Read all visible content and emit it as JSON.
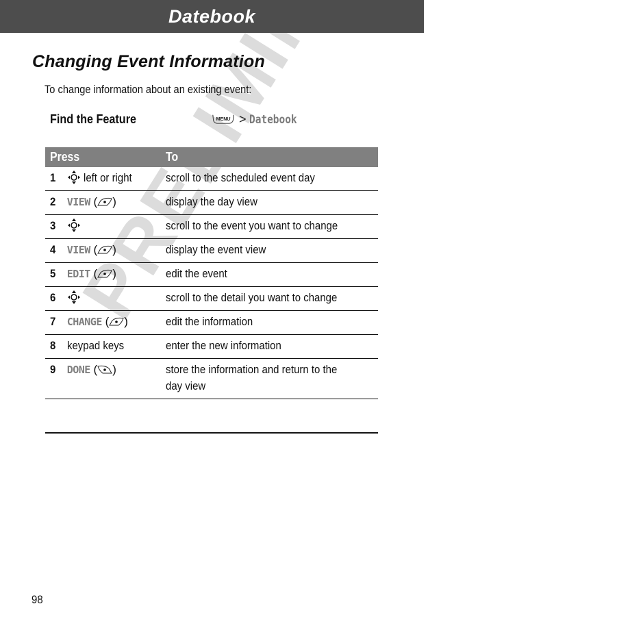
{
  "header": {
    "title": "Datebook"
  },
  "section": {
    "title": "Changing Event Information",
    "intro": "To change information about an existing event:"
  },
  "find_feature": {
    "label": "Find the Feature",
    "menu_key_label": "MENU",
    "separator": ">",
    "path": "Datebook"
  },
  "table": {
    "headers": {
      "press": "Press",
      "to": "To"
    },
    "rows": [
      {
        "num": "1",
        "press_icon": "nav-key-icon",
        "press_softkey": "",
        "press_text": "left or right",
        "key_glyph": "",
        "to": "scroll to the scheduled event day"
      },
      {
        "num": "2",
        "press_icon": "",
        "press_softkey": "VIEW",
        "press_text": "",
        "key_glyph": "right-soft-key-icon",
        "to": "display the day view"
      },
      {
        "num": "3",
        "press_icon": "nav-key-icon",
        "press_softkey": "",
        "press_text": "",
        "key_glyph": "",
        "to": "scroll to the event you want to change"
      },
      {
        "num": "4",
        "press_icon": "",
        "press_softkey": "VIEW",
        "press_text": "",
        "key_glyph": "right-soft-key-icon",
        "to": "display the event view"
      },
      {
        "num": "5",
        "press_icon": "",
        "press_softkey": "EDIT",
        "press_text": "",
        "key_glyph": "right-soft-key-icon",
        "to": "edit the event"
      },
      {
        "num": "6",
        "press_icon": "nav-key-icon",
        "press_softkey": "",
        "press_text": "",
        "key_glyph": "",
        "to": "scroll to the detail you want to change"
      },
      {
        "num": "7",
        "press_icon": "",
        "press_softkey": "CHANGE",
        "press_text": "",
        "key_glyph": "right-soft-key-icon",
        "to": "edit the information"
      },
      {
        "num": "8",
        "press_icon": "",
        "press_softkey": "",
        "press_text": "keypad keys",
        "key_glyph": "",
        "to": "enter the new information"
      },
      {
        "num": "9",
        "press_icon": "",
        "press_softkey": "DONE",
        "press_text": "",
        "key_glyph": "left-soft-key-icon",
        "to": "store the information and return to the day view"
      }
    ]
  },
  "watermark": "PRELIMINARY",
  "footer": {
    "page_number": "98"
  }
}
